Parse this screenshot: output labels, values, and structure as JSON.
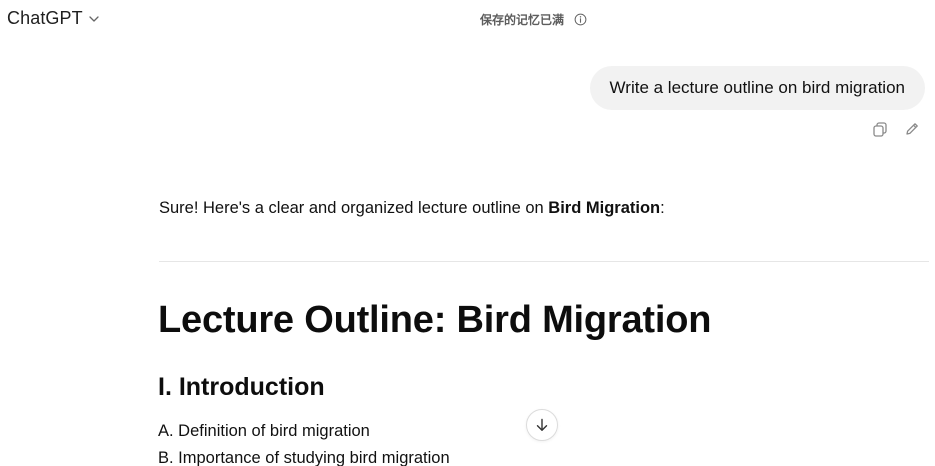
{
  "header": {
    "model_name": "ChatGPT",
    "memory_status": "保存的记忆已满"
  },
  "user_message": {
    "text": "Write a lecture outline on bird migration"
  },
  "assistant": {
    "intro_prefix": "Sure! Here's a clear and organized lecture outline on ",
    "intro_bold": "Bird Migration",
    "intro_suffix": ":",
    "heading": "Lecture Outline: Bird Migration",
    "section_title": "I. Introduction",
    "items": [
      "A. Definition of bird migration",
      "B. Importance of studying bird migration"
    ]
  },
  "icons": {
    "model_menu": "chevron-down-icon",
    "memory_info": "info-icon",
    "copy": "copy-icon",
    "edit": "pencil-icon",
    "scroll_down": "arrow-down-icon"
  }
}
